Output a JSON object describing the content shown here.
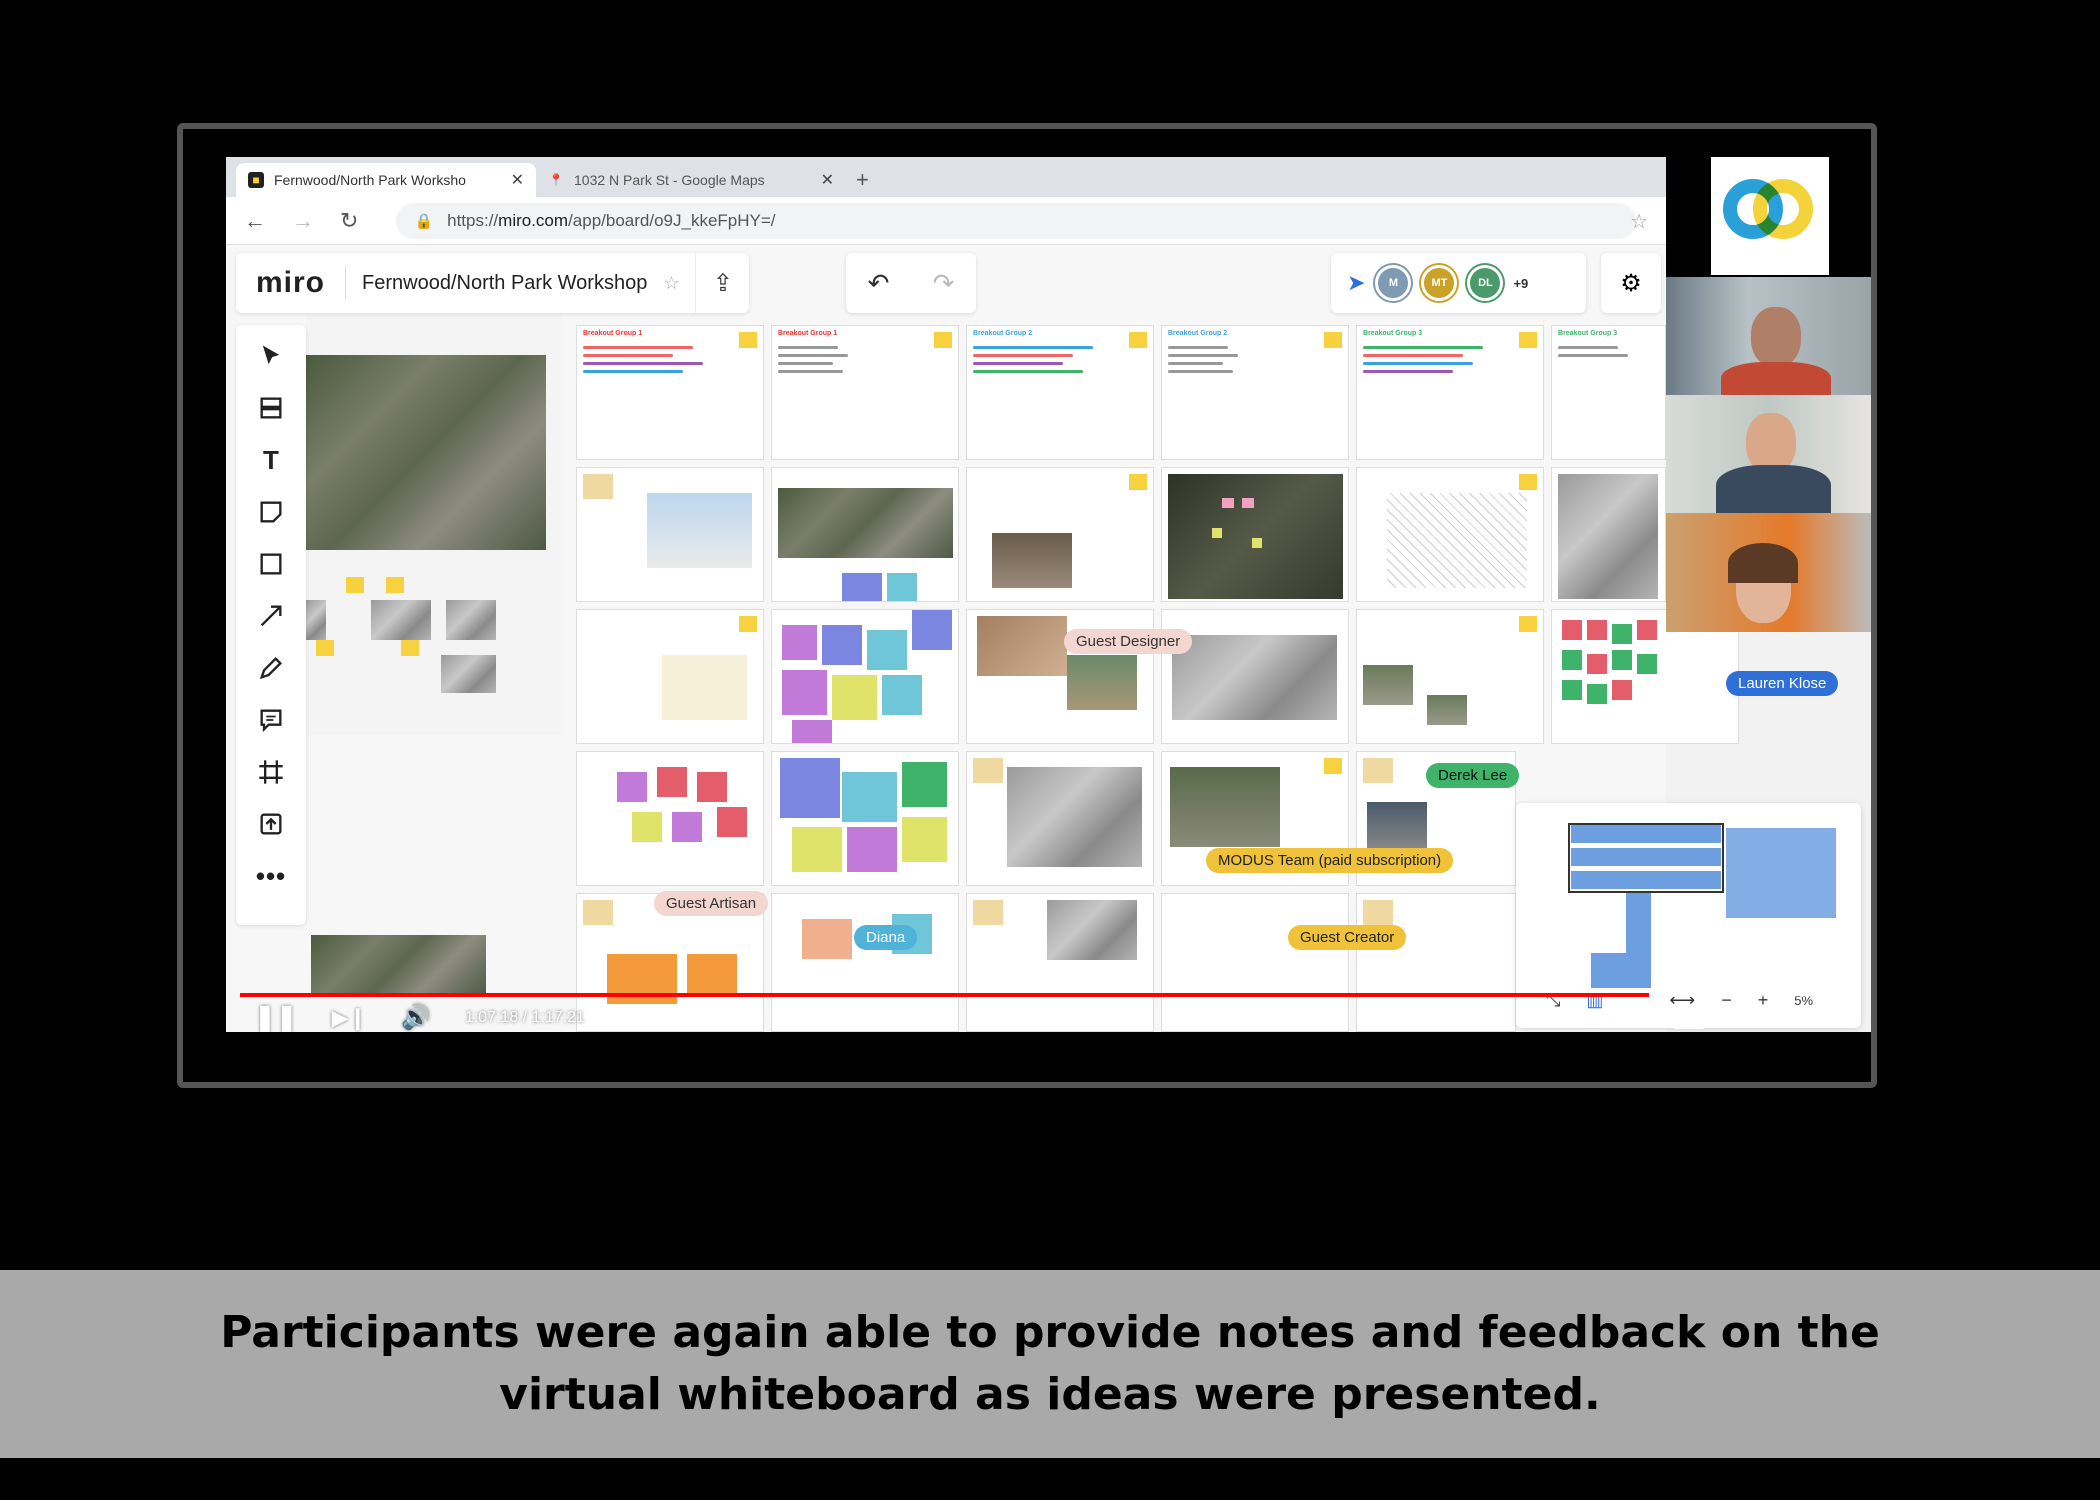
{
  "browser": {
    "tabs": [
      {
        "label": "Fernwood/North Park Worksho",
        "active": true
      },
      {
        "label": "1032 N Park St - Google Maps",
        "active": false
      }
    ],
    "url_prefix": "https://",
    "url_host": "miro.com",
    "url_path": "/app/board/o9J_kkeFpHY=/"
  },
  "miro": {
    "logo": "miro",
    "board_title": "Fernwood/North Park Workshop",
    "collaborators": [
      {
        "initials": "M",
        "color": "#7e9bb3"
      },
      {
        "initials": "MT",
        "color": "#c9a227"
      },
      {
        "initials": "DL",
        "color": "#4a9a6a"
      }
    ],
    "more_collaborators": "+9",
    "frame_headers": [
      "Breakout Group 1",
      "Breakout Group 1",
      "Breakout Group 2",
      "Breakout Group 2",
      "Breakout Group 3",
      "Breakout Group 3"
    ],
    "cursors": [
      {
        "name": "Guest Designer",
        "bg": "#f3d6d0",
        "fg": "#333"
      },
      {
        "name": "Lauren Klose",
        "bg": "#2f6fd8",
        "fg": "#ffffff"
      },
      {
        "name": "Derek Lee",
        "bg": "#3fb36a",
        "fg": "#111"
      },
      {
        "name": "MODUS Team (paid subscription)",
        "bg": "#f0c23a",
        "fg": "#222"
      },
      {
        "name": "Guest Artisan",
        "bg": "#f3d6d0",
        "fg": "#333"
      },
      {
        "name": "Diana",
        "bg": "#4fb2d6",
        "fg": "#fff"
      },
      {
        "name": "Guest Creator",
        "bg": "#f0c23a",
        "fg": "#222"
      }
    ],
    "zoom": "5%",
    "icons": [
      "select-icon",
      "templates-icon",
      "text-icon",
      "sticky-note-icon",
      "shape-icon",
      "arrow-icon",
      "pen-icon",
      "comment-icon",
      "frame-icon",
      "upload-icon",
      "more-icon"
    ]
  },
  "player": {
    "time": "1:07:18 / 1:17:21",
    "progress": 0.87
  },
  "caption": {
    "line1": "Participants were again able to provide notes and feedback on the",
    "line2": "virtual whiteboard as ideas were presented."
  }
}
